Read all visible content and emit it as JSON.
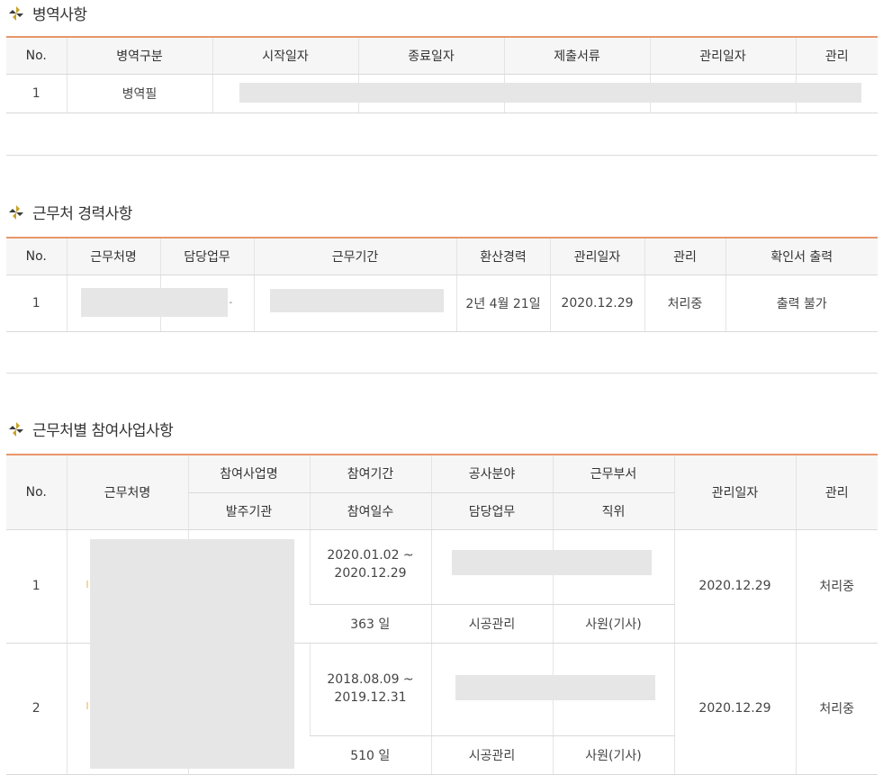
{
  "military": {
    "title": "병역사항",
    "headers": [
      "No.",
      "병역구분",
      "시작일자",
      "종료일자",
      "제출서류",
      "관리일자",
      "관리"
    ],
    "rows": [
      {
        "no": "1",
        "type": "병역필"
      }
    ]
  },
  "career": {
    "title": "근무처 경력사항",
    "headers": [
      "No.",
      "근무처명",
      "담당업무",
      "근무기간",
      "환산경력",
      "관리일자",
      "관리",
      "확인서 출력"
    ],
    "rows": [
      {
        "no": "1",
        "duty": "-",
        "converted": "2년 4월 21일",
        "managed_date": "2020.12.29",
        "status": "처리중",
        "print": "출력 불가"
      }
    ]
  },
  "projects": {
    "title": "근무처별 참여사업사항",
    "headers": {
      "no": "No.",
      "workplace": "근무처명",
      "project_name": "참여사업명",
      "client": "발주기관",
      "period": "참여기간",
      "days": "참여일수",
      "field": "공사분야",
      "duty": "담당업무",
      "dept": "근무부서",
      "position": "직위",
      "managed_date": "관리일자",
      "manage": "관리"
    },
    "rows": [
      {
        "no": "1",
        "period": "2020.01.02 ~\n2020.12.29",
        "days": "363 일",
        "duty": "시공관리",
        "position": "사원(기사)",
        "managed_date": "2020.12.29",
        "status": "처리중"
      },
      {
        "no": "2",
        "period": "2018.08.09 ~\n2019.12.31",
        "days": "510 일",
        "duty": "시공관리",
        "position": "사원(기사)",
        "managed_date": "2020.12.29",
        "status": "처리중"
      }
    ]
  },
  "colors": {
    "accent_line": "#e8956a",
    "header_bg": "#f6f6f6",
    "redaction": "#e6e6e6",
    "icon_gold": "#c9a227",
    "icon_dark": "#3a3a3a"
  },
  "icons": {
    "section": "pinwheel-icon"
  }
}
